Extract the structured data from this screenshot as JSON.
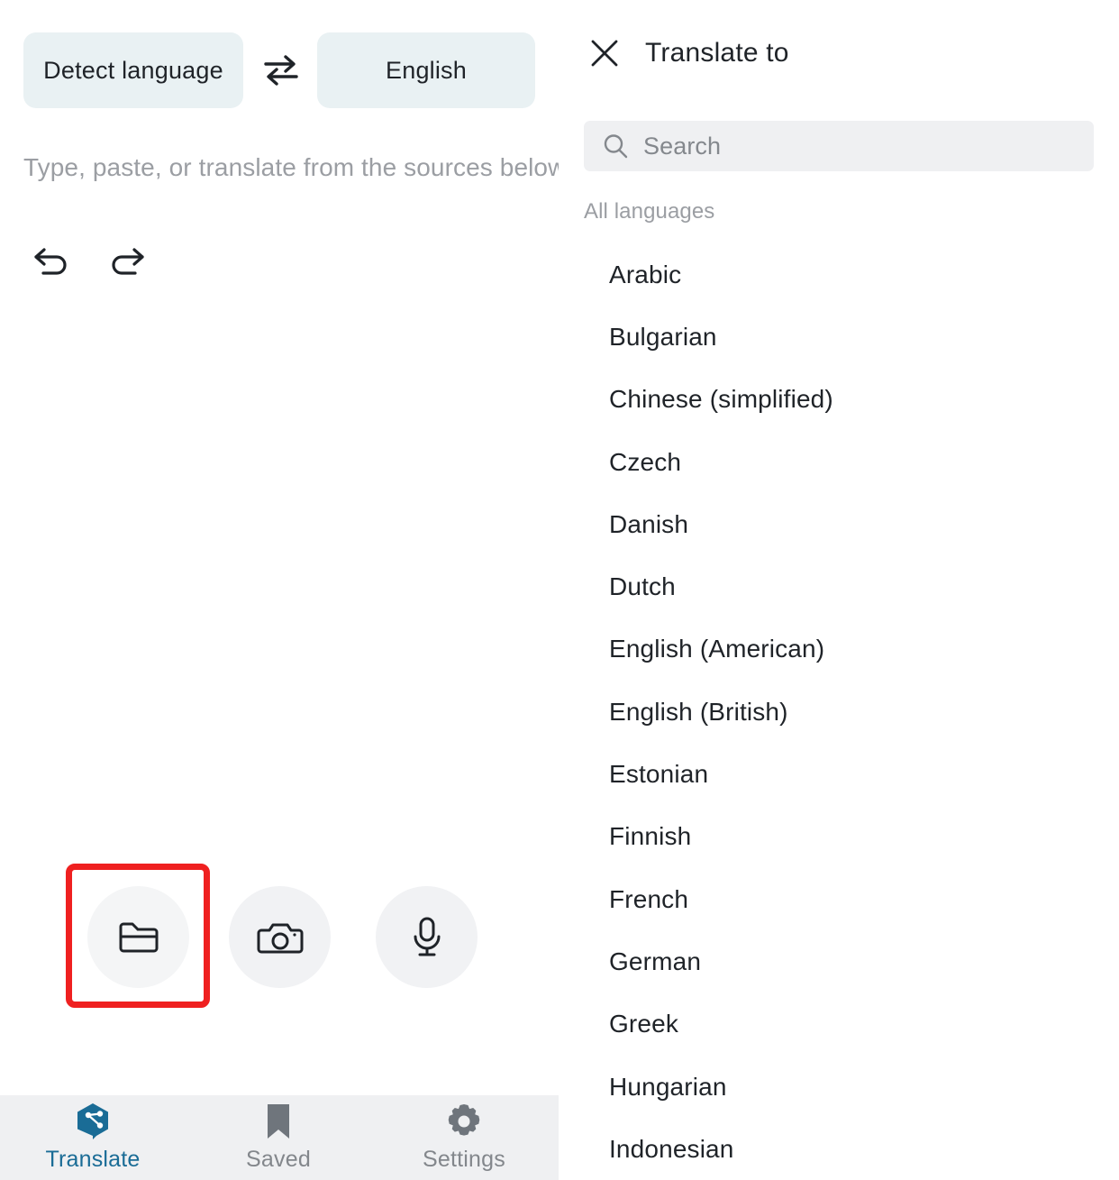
{
  "left": {
    "language_bar": {
      "source_language": "Detect language",
      "target_language": "English",
      "swap_icon": "swap-horizontal-icon"
    },
    "input_placeholder": "Type, paste, or translate from the sources below",
    "history": {
      "undo_icon": "undo-arrow-icon",
      "redo_icon": "redo-arrow-icon"
    },
    "source_actions": [
      {
        "name": "file",
        "icon": "folder-icon",
        "highlighted": true
      },
      {
        "name": "camera",
        "icon": "camera-icon",
        "highlighted": false
      },
      {
        "name": "microphone",
        "icon": "microphone-icon",
        "highlighted": false
      }
    ],
    "highlight_color": "#ef2020",
    "tab_bar": {
      "active_color": "#1a6c96",
      "inactive_color": "#83878c",
      "tabs": [
        {
          "label": "Translate",
          "icon": "translate-hexagon-icon",
          "active": true
        },
        {
          "label": "Saved",
          "icon": "bookmark-icon",
          "active": false
        },
        {
          "label": "Settings",
          "icon": "gear-icon",
          "active": false
        }
      ]
    }
  },
  "right": {
    "title": "Translate to",
    "close_icon": "close-x-icon",
    "search": {
      "placeholder": "Search",
      "value": "",
      "icon": "search-icon"
    },
    "section_label": "All languages",
    "languages": [
      "Arabic",
      "Bulgarian",
      "Chinese (simplified)",
      "Czech",
      "Danish",
      "Dutch",
      "English (American)",
      "English (British)",
      "Estonian",
      "Finnish",
      "French",
      "German",
      "Greek",
      "Hungarian",
      "Indonesian"
    ]
  }
}
